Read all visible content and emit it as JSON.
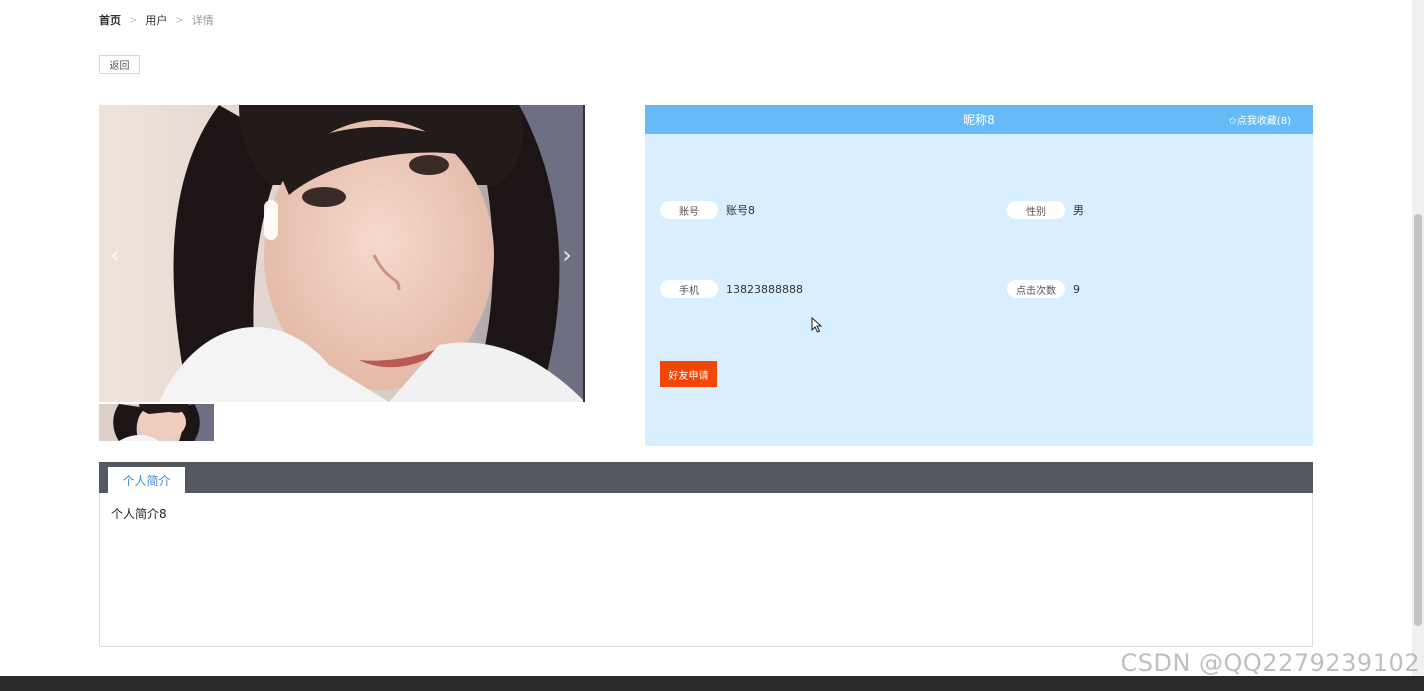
{
  "breadcrumb": {
    "items": [
      "首页",
      "用户"
    ],
    "current": "详情",
    "separator": ">"
  },
  "back_button": {
    "label": "返回"
  },
  "gallery": {
    "prev_icon": "chevron-left-icon",
    "next_icon": "chevron-right-icon",
    "prev_glyph": "‹",
    "next_glyph": "›"
  },
  "profile": {
    "title": "昵称8",
    "favorite_label": "✩点我收藏(8)",
    "fields": [
      {
        "label": "账号",
        "value": "账号8"
      },
      {
        "label": "性别",
        "value": "男"
      },
      {
        "label": "手机",
        "value": "13823888888"
      },
      {
        "label": "点击次数",
        "value": "9"
      }
    ],
    "friend_request_label": "好友申请",
    "header_color": "#66bbf6",
    "panel_color": "#d9efff",
    "button_color": "#f24606"
  },
  "tabs": {
    "items": [
      {
        "label": "个人简介"
      }
    ],
    "active_content": "个人简介8"
  },
  "watermark": "CSDN @QQ2279239102"
}
